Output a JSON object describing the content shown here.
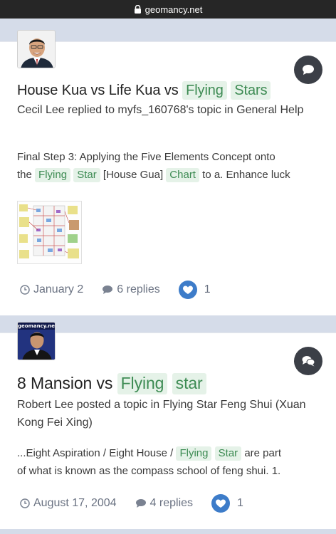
{
  "browser": {
    "url": "geomancy.net"
  },
  "results": [
    {
      "title_parts": [
        {
          "text": "House Kua vs Life Kua vs ",
          "hl": false
        },
        {
          "text": "Flying",
          "hl": true
        },
        {
          "text": "Stars",
          "hl": true
        }
      ],
      "meta": "Cecil Lee replied to myfs_160768's topic in General Help",
      "snippet_line1": {
        "text": "Final Step 3: Applying the Five Elements Concept onto"
      },
      "snippet_line2": [
        {
          "text": "the ",
          "hl": false
        },
        {
          "text": "Flying",
          "hl": true
        },
        {
          "text": "Star",
          "hl": true
        },
        {
          "text": " [House Gua] ",
          "hl": false
        },
        {
          "text": "Chart",
          "hl": true
        },
        {
          "text": " to a. Enhance luck",
          "hl": false
        }
      ],
      "date": "January 2",
      "replies": "6 replies",
      "likes": "1",
      "bubble_icon": "comment-icon"
    },
    {
      "title_parts": [
        {
          "text": "8 Mansion vs ",
          "hl": false
        },
        {
          "text": "Flying",
          "hl": true
        },
        {
          "text": "star",
          "hl": true
        }
      ],
      "meta": "Robert Lee posted a topic in Flying Star Feng Shui (Xuan Kong Fei Xing)",
      "snippet_line1_parts": [
        {
          "text": "...Eight Aspiration / Eight House / ",
          "hl": false
        },
        {
          "text": "Flying",
          "hl": true
        },
        {
          "text": "Star",
          "hl": true
        },
        {
          "text": " are part",
          "hl": false
        }
      ],
      "snippet_line2_text": "of what is known as the compass school of feng shui. 1.",
      "avatar_label": "geomancy.net",
      "date": "August 17, 2004",
      "replies": "4 replies",
      "likes": "1",
      "bubble_icon": "comments-icon"
    }
  ],
  "colors": {
    "highlight_bg": "#e5f2e8",
    "highlight_text": "#3d8b53",
    "separator": "#d5dce9",
    "like_blue": "#3d7cc9",
    "bubble_dark": "#3b3f47"
  }
}
